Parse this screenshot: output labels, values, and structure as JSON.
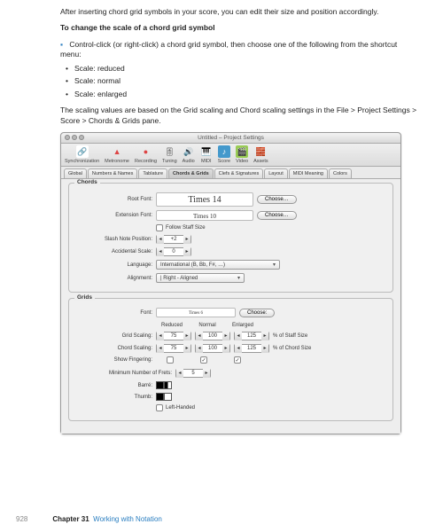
{
  "intro": "After inserting chord grid symbols in your score, you can edit their size and position accordingly.",
  "heading": "To change the scale of a chord grid symbol",
  "step": "Control-click (or right-click) a chord grid symbol, then choose one of the following from the shortcut menu:",
  "opts": {
    "a": "Scale:  reduced",
    "b": "Scale:  normal",
    "c": "Scale:  enlarged"
  },
  "summary": "The scaling values are based on the Grid scaling and Chord scaling settings in the File > Project Settings > Score > Chords & Grids pane.",
  "window": {
    "title": "Untitled – Project Settings",
    "toolbar": [
      {
        "label": "Synchronization",
        "glyph": "🔗",
        "bg": "#fff"
      },
      {
        "label": "Metronome",
        "glyph": "▲",
        "bg": "#d44"
      },
      {
        "label": "Recording",
        "glyph": "●",
        "bg": "#d44"
      },
      {
        "label": "Tuning",
        "glyph": "🎚",
        "bg": "#eee"
      },
      {
        "label": "Audio",
        "glyph": "🔊",
        "bg": "#eee"
      },
      {
        "label": "MIDI",
        "glyph": "🎹",
        "bg": "#eee"
      },
      {
        "label": "Score",
        "glyph": "♪",
        "bg": "#49c"
      },
      {
        "label": "Video",
        "glyph": "🎬",
        "bg": "#9c5"
      },
      {
        "label": "Assets",
        "glyph": "🧱",
        "bg": "#eee"
      }
    ],
    "tabs": [
      "Global",
      "Numbers & Names",
      "Tablature",
      "Chords & Grids",
      "Clefs & Signatures",
      "Layout",
      "MIDI Meaning",
      "Colors"
    ],
    "active_tab": 3,
    "chords": {
      "title": "Chords",
      "root_label": "Root Font:",
      "root_sample": "Times 14",
      "ext_label": "Extension Font:",
      "ext_sample": "Times 10",
      "choose": "Choose…",
      "follow": "Follow Staff Size",
      "slash_label": "Slash Note Position:",
      "slash_val": "+2",
      "accidental_label": "Accidental Scale:",
      "accidental_val": "0",
      "lang_label": "Language:",
      "lang_val": "International (B, Bb, F#, …)",
      "align_label": "Alignment:",
      "align_val": "| Right - Aligned"
    },
    "grids": {
      "title": "Grids",
      "font_label": "Font:",
      "font_sample": "Times 6",
      "choose": "Choose:",
      "cols": {
        "r": "Reduced",
        "n": "Normal",
        "e": "Enlarged"
      },
      "gridscale_label": "Grid Scaling:",
      "gridscale": {
        "r": "75",
        "n": "100",
        "e": "125"
      },
      "gridscale_unit": "% of Staff Size",
      "chordscale_label": "Chord Scaling:",
      "chordscale": {
        "r": "75",
        "n": "100",
        "e": "125"
      },
      "chordscale_unit": "% of Chord Size",
      "showfing_label": "Show Fingering:",
      "frets_label": "Minimum Number of Frets:",
      "frets_val": "5",
      "barre_label": "Barré:",
      "thumb_label": "Thumb:",
      "lefthanded": "Left-Handed"
    }
  },
  "footer": {
    "page": "928",
    "chapter": "Chapter 31",
    "title": "Working with Notation"
  }
}
